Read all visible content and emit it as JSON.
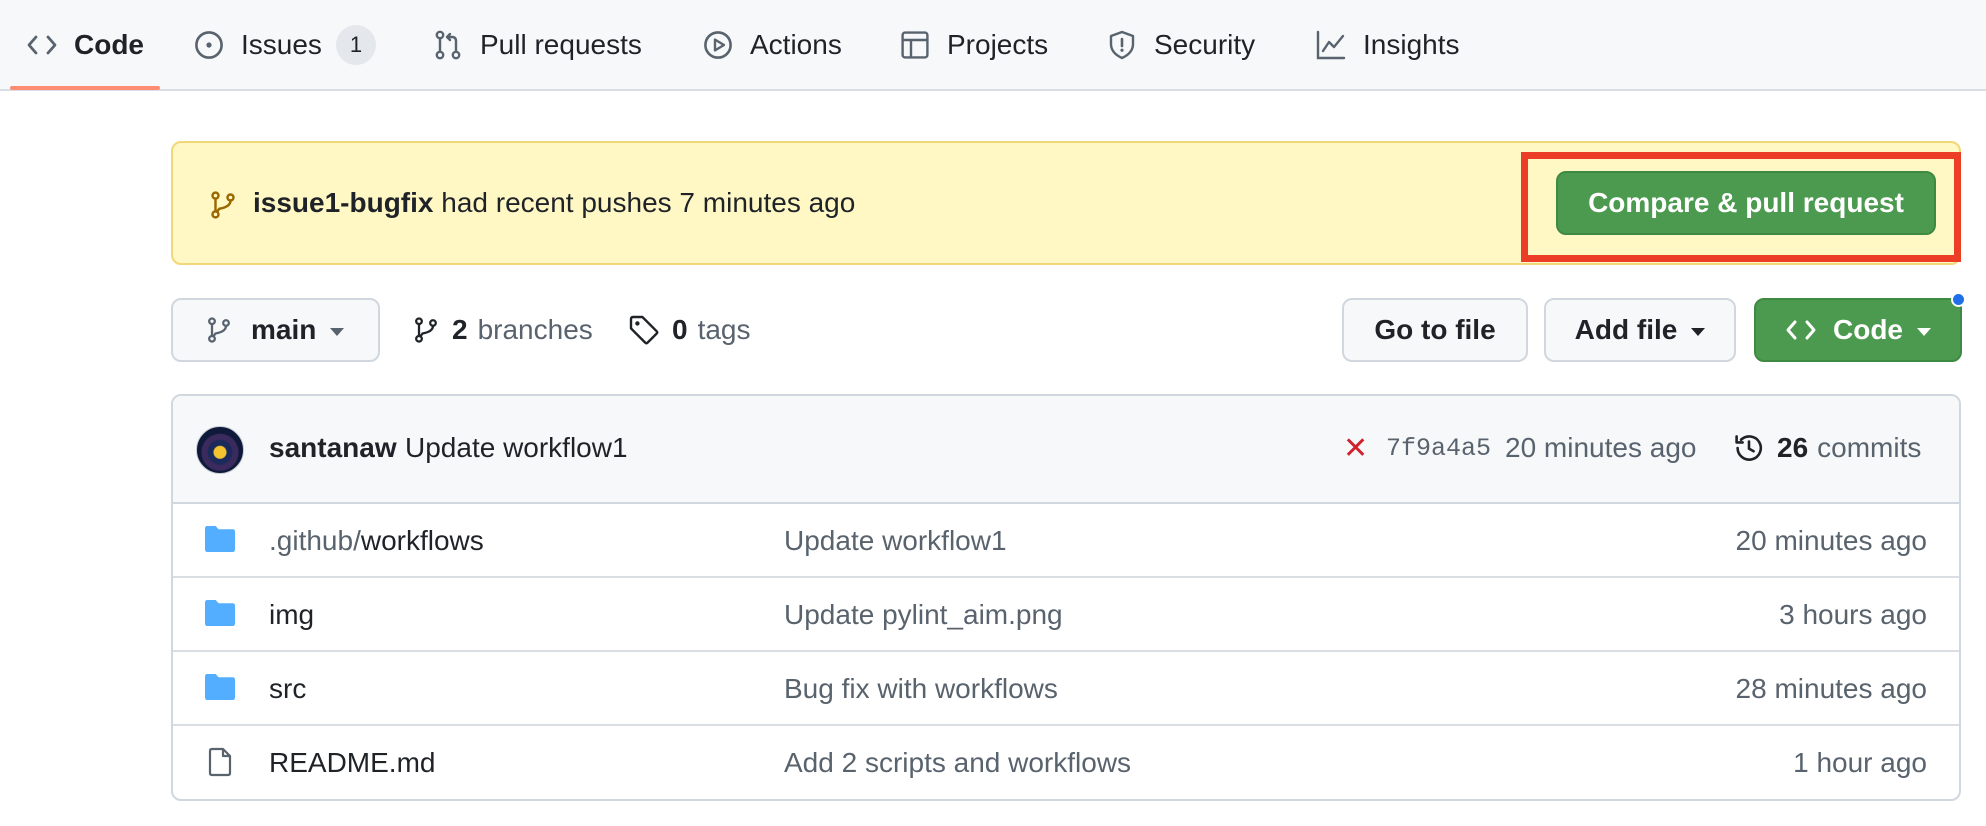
{
  "nav": {
    "tabs": [
      {
        "label": "Code",
        "icon": "code-icon",
        "selected": true
      },
      {
        "label": "Issues",
        "icon": "issue-icon",
        "counter": "1"
      },
      {
        "label": "Pull requests",
        "icon": "pull-request-icon"
      },
      {
        "label": "Actions",
        "icon": "play-icon"
      },
      {
        "label": "Projects",
        "icon": "table-icon"
      },
      {
        "label": "Security",
        "icon": "shield-icon"
      },
      {
        "label": "Insights",
        "icon": "graph-icon"
      }
    ]
  },
  "banner": {
    "branch": "issue1-bugfix",
    "text": "had recent pushes 7 minutes ago",
    "button_label": "Compare & pull request",
    "icon": "git-branch-icon",
    "highlight_color": "#ec3d26"
  },
  "toolbar": {
    "branch_label": "main",
    "branches_count": "2",
    "branches_label": "branches",
    "tags_count": "0",
    "tags_label": "tags",
    "goto_label": "Go to file",
    "addfile_label": "Add file",
    "code_label": "Code"
  },
  "commit": {
    "author": "santanaw",
    "message": "Update workflow1",
    "status": "✕",
    "sha": "7f9a4a5",
    "time": "20 minutes ago",
    "count": "26",
    "count_label": "commits"
  },
  "files": [
    {
      "prefix": ".github/",
      "name": "workflows",
      "type": "folder",
      "message": "Update workflow1",
      "time": "20 minutes ago"
    },
    {
      "prefix": "",
      "name": "img",
      "type": "folder",
      "message": "Update pylint_aim.png",
      "time": "3 hours ago"
    },
    {
      "prefix": "",
      "name": "src",
      "type": "folder",
      "message": "Bug fix with workflows",
      "time": "28 minutes ago"
    },
    {
      "prefix": "",
      "name": "README.md",
      "type": "file",
      "message": "Add 2 scripts and workflows",
      "time": "1 hour ago"
    }
  ],
  "colors": {
    "green_button": "#4c9a4f",
    "banner_bg": "#fff8c5",
    "folder": "#54aeff",
    "tab_underline": "#fd8c73",
    "error": "#cf222e"
  }
}
